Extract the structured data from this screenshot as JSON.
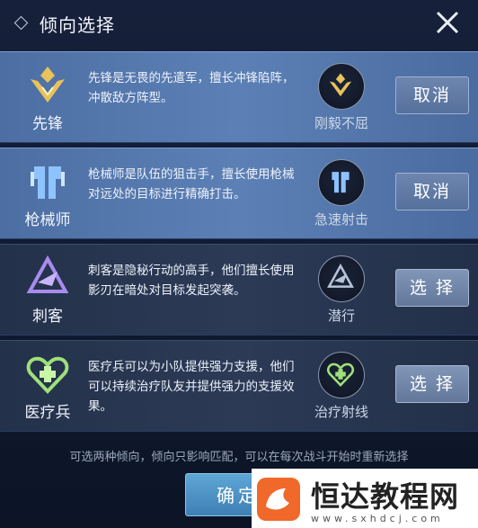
{
  "header": {
    "title": "倾向选择",
    "close_icon": "close-icon"
  },
  "cards": [
    {
      "role": "先锋",
      "desc": "先锋是无畏的先遣军，擅长冲锋陷阵，冲散敌方阵型。",
      "skill": "刚毅不屈",
      "button": "取消",
      "state": "selected",
      "icon": "vanguard-icon",
      "skill_icon": "vanguard-skill-icon"
    },
    {
      "role": "枪械师",
      "desc": "枪械师是队伍的狙击手，擅长使用枪械对远处的目标进行精确打击。",
      "skill": "急速射击",
      "button": "取消",
      "state": "selected",
      "icon": "gunsmith-icon",
      "skill_icon": "gunsmith-skill-icon"
    },
    {
      "role": "刺客",
      "desc": "刺客是隐秘行动的高手，他们擅长使用影刃在暗处对目标发起突袭。",
      "skill": "潜行",
      "button": "选 择",
      "state": "unselected",
      "icon": "assassin-icon",
      "skill_icon": "assassin-skill-icon"
    },
    {
      "role": "医疗兵",
      "desc": "医疗兵可以为小队提供强力支援，他们可以持续治疗队友并提供强力的支援效果。",
      "skill": "治疗射线",
      "button": "选 择",
      "state": "unselected",
      "icon": "medic-icon",
      "skill_icon": "medic-skill-icon"
    }
  ],
  "footer": {
    "note": "可选两种倾向，倾向只影响匹配，可以在每次战斗开始时重新选择",
    "confirm": "确定"
  },
  "watermark": {
    "name": "恒达教程网",
    "url": "www.sxhdcj.com"
  },
  "colors": {
    "gold": "#e8c25a",
    "purple": "#a98bf0",
    "green": "#9fe07a",
    "blue": "#8ec3ff"
  }
}
